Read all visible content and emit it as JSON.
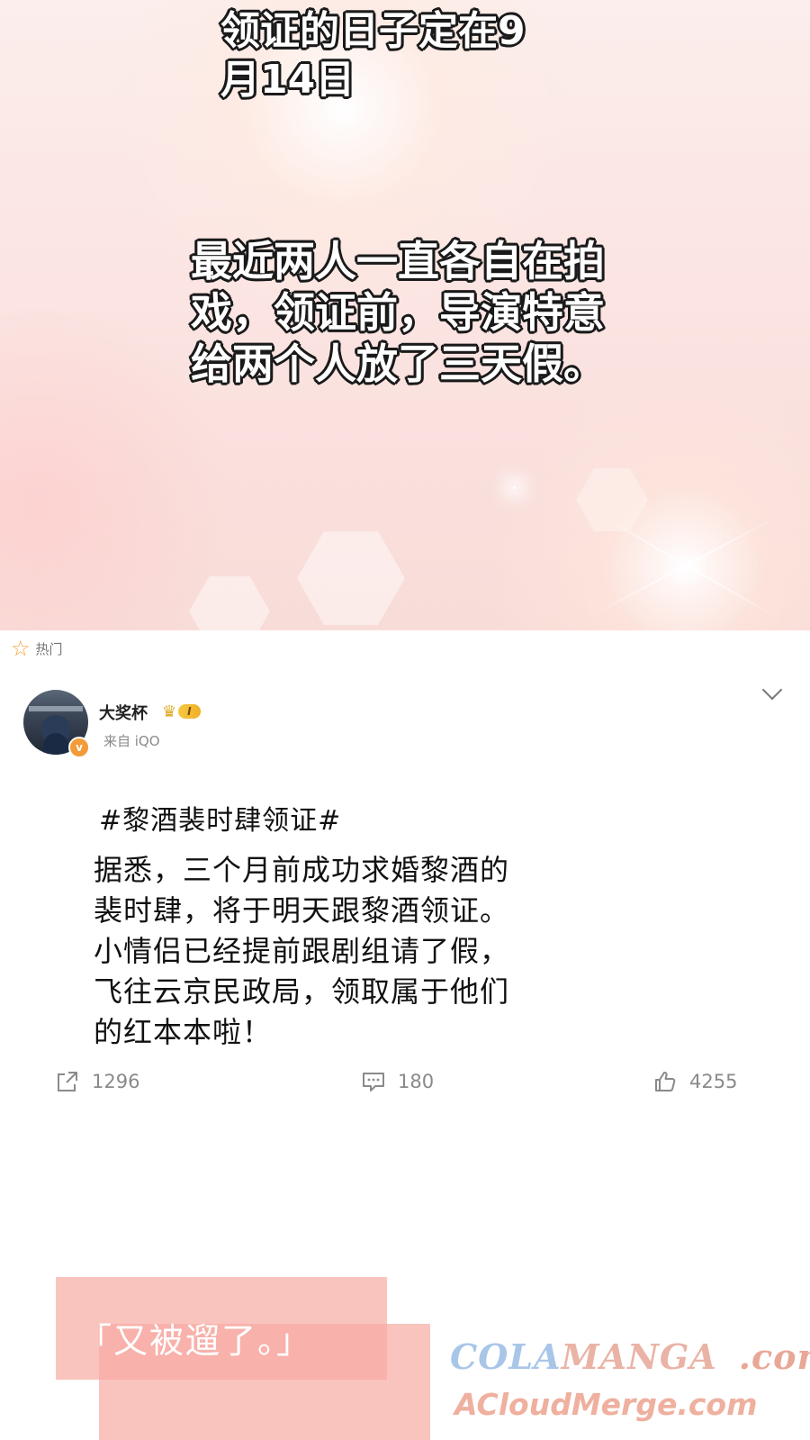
{
  "top_panel": {
    "caption_1": "领证的日子定在9月14日",
    "caption_2": "最近两人一直各自在拍戏，领证前，导演特意给两个人放了三天假。"
  },
  "post": {
    "section_label": "热门",
    "user": {
      "name": "大奖杯",
      "level": "I",
      "source": "来自 iQO"
    },
    "hashtag": "#黎酒裴时肆领证#",
    "body": "据悉，三个月前成功求婚黎酒的裴时肆，将于明天跟黎酒领证。小情侣已经提前跟剧组请了假，飞往云京民政局，领取属于他们的红本本啦！",
    "actions": {
      "reposts": "1296",
      "comments": "180",
      "likes": "4255"
    },
    "icons": [
      "star-icon",
      "chevron-down-icon",
      "verified-icon",
      "crown-icon",
      "share-icon",
      "comment-icon",
      "like-icon"
    ]
  },
  "bottom_caption": "「又被遛了。」",
  "watermark": {
    "line1_a": "COLA",
    "line1_b": "MANGA",
    "line1_c": ".com",
    "line2": "ACloudMerge.com"
  }
}
